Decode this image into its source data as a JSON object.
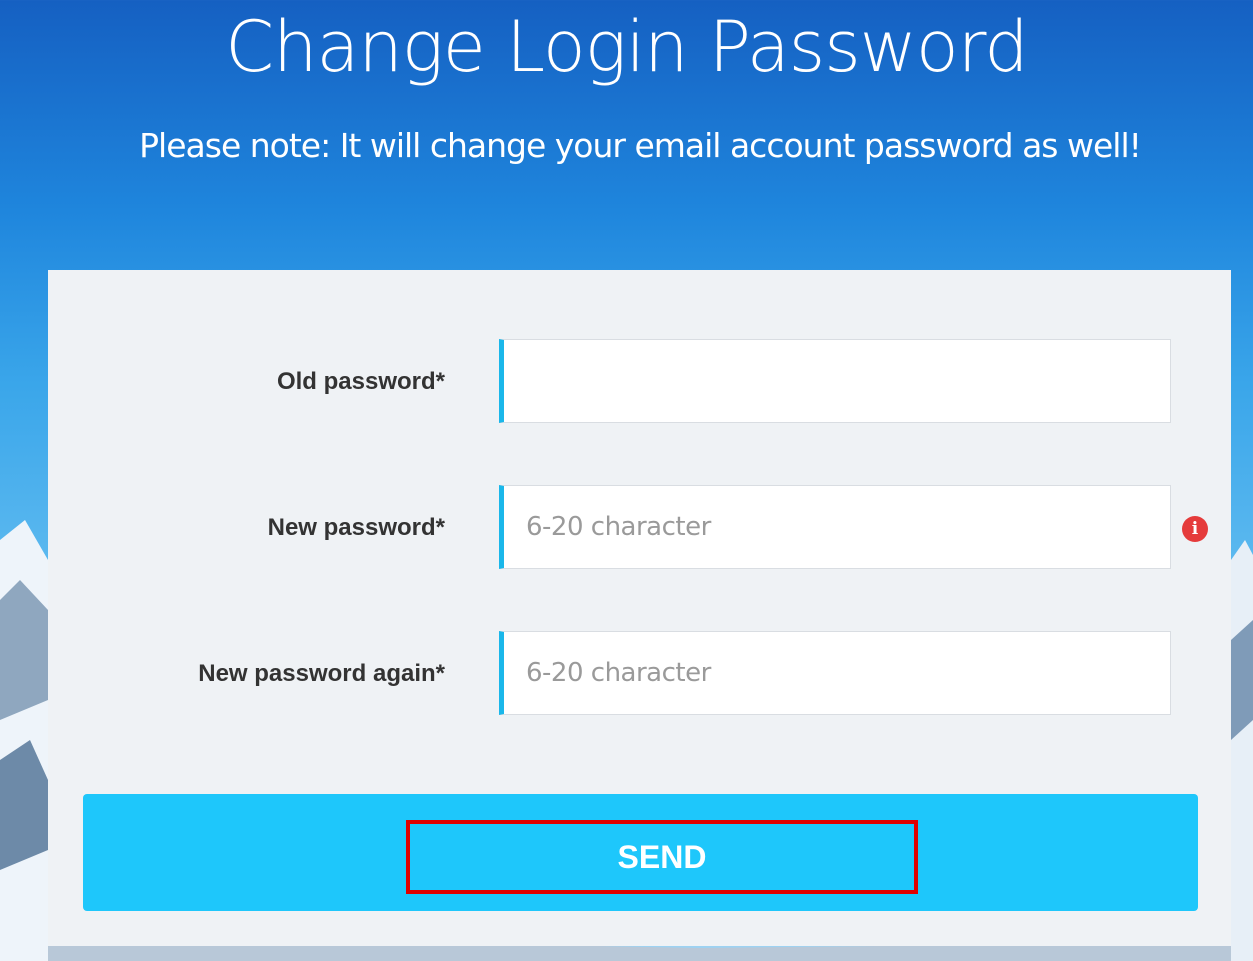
{
  "header": {
    "title": "Change Login Password",
    "note": "Please note: It will change your email account password as well!"
  },
  "form": {
    "old_password": {
      "label": "Old password*",
      "value": "",
      "placeholder": ""
    },
    "new_password": {
      "label": "New password*",
      "value": "",
      "placeholder": "6-20 character",
      "info_icon": "info-icon"
    },
    "new_password_again": {
      "label": "New password again*",
      "value": "",
      "placeholder": "6-20 character"
    },
    "send_label": "SEND"
  },
  "colors": {
    "accent": "#1ec7fb",
    "input_border_accent": "#1ab7ea",
    "info_icon": "#e53b3b",
    "highlight_box": "#e00000",
    "panel": "#eff2f5"
  }
}
